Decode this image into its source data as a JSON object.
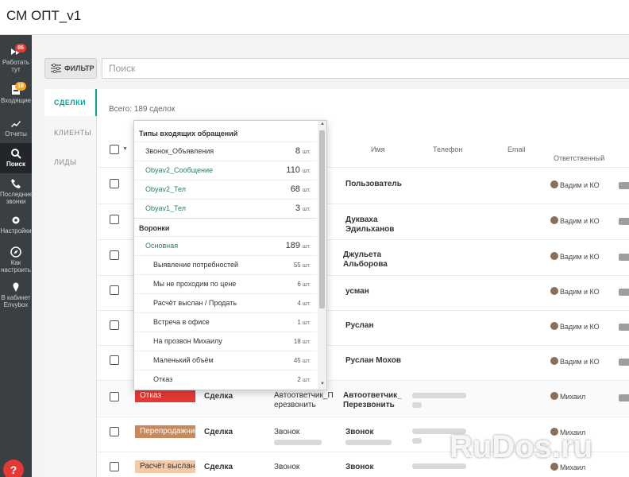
{
  "app_title": "СМ ОПТ_v1",
  "sidebar": {
    "items": [
      {
        "label": "Работать тут",
        "icon": "fast-forward-icon",
        "badge": "86"
      },
      {
        "label": "Входящие",
        "icon": "inbox-icon",
        "badge": "18"
      },
      {
        "label": "Отчеты",
        "icon": "trending-up-icon"
      },
      {
        "label": "Поиск",
        "icon": "search-icon",
        "active": true
      },
      {
        "label": "Последние звонки",
        "icon": "phone-icon"
      },
      {
        "label": "Настройки",
        "icon": "gear-icon"
      },
      {
        "label": "Как настроить",
        "icon": "compass-icon"
      },
      {
        "label": "В кабинет Envybox",
        "icon": "ice-cream-icon"
      }
    ],
    "help_label": "?"
  },
  "filter": {
    "label": "ФИЛЬТР"
  },
  "search": {
    "placeholder": "Поиск",
    "value": ""
  },
  "tabs": [
    {
      "label": "СДЕЛКИ",
      "active": true
    },
    {
      "label": "КЛИЕНТЫ"
    },
    {
      "label": "ЛИДЫ"
    }
  ],
  "total_text": "Всего: 189 сделок",
  "columns": {
    "name": "Имя",
    "phone": "Телефон",
    "email": "Email",
    "responsible": "Ответственный"
  },
  "rows": [
    {
      "name": "Пользователь",
      "responsible": "Вадим и КО"
    },
    {
      "name": "Дукваха Эдильханов",
      "responsible": "Вадим и КО"
    },
    {
      "name": "Джульета Альборова",
      "responsible": "Вадим и КО"
    },
    {
      "name": "усман",
      "responsible": "Вадим и КО"
    },
    {
      "name": "Руслан",
      "responsible": "Вадим и КО"
    },
    {
      "name": "Руслан Мохов",
      "responsible": "Вадим и КО"
    },
    {
      "stage": "Отказ",
      "type": "Сделка",
      "source": "Автоответчик_Перезвонить",
      "name": "Автоответчик_Перезвонить",
      "responsible": "Михаил"
    },
    {
      "stage": "Перепродажние",
      "type": "Сделка",
      "source": "Звонок",
      "name": "Звонок",
      "responsible": "Михаил"
    },
    {
      "stage": "Расчёт выслан",
      "type": "Сделка",
      "source": "Звонок",
      "name": "Звонок",
      "responsible": "Михаил"
    }
  ],
  "stage_colors": {
    "Отказ": "#e53935",
    "Перепродажние": "#c8885a",
    "Расчёт выслан": "#f6c9a6"
  },
  "dropdown": {
    "group1_title": "Типы входящих обращений",
    "group1": [
      {
        "label": "Звонок_Объявления",
        "count": "8",
        "unit": "шт."
      },
      {
        "label": "Obyav2_Сообщение",
        "count": "110",
        "unit": "шт."
      },
      {
        "label": "Obyav2_Тел",
        "count": "68",
        "unit": "шт."
      },
      {
        "label": "Obyav1_Тел",
        "count": "3",
        "unit": "шт."
      }
    ],
    "group2_title": "Воронки",
    "funnel": {
      "label": "Основная",
      "count": "189",
      "unit": "шт."
    },
    "stages": [
      {
        "label": "Выявление потребностей",
        "count": "55",
        "unit": "шт."
      },
      {
        "label": "Мы не проходим по цене",
        "count": "6",
        "unit": "шт."
      },
      {
        "label": "Расчёт выслан / Продать",
        "count": "4",
        "unit": "шт."
      },
      {
        "label": "Встреча в офисе",
        "count": "1",
        "unit": "шт."
      },
      {
        "label": "На прозвон Михаилу",
        "count": "18",
        "unit": "шт."
      },
      {
        "label": "Маленький объём",
        "count": "45",
        "unit": "шт."
      },
      {
        "label": "Отказ",
        "count": "2",
        "unit": "шт."
      }
    ]
  },
  "watermark": "RuDos.ru"
}
